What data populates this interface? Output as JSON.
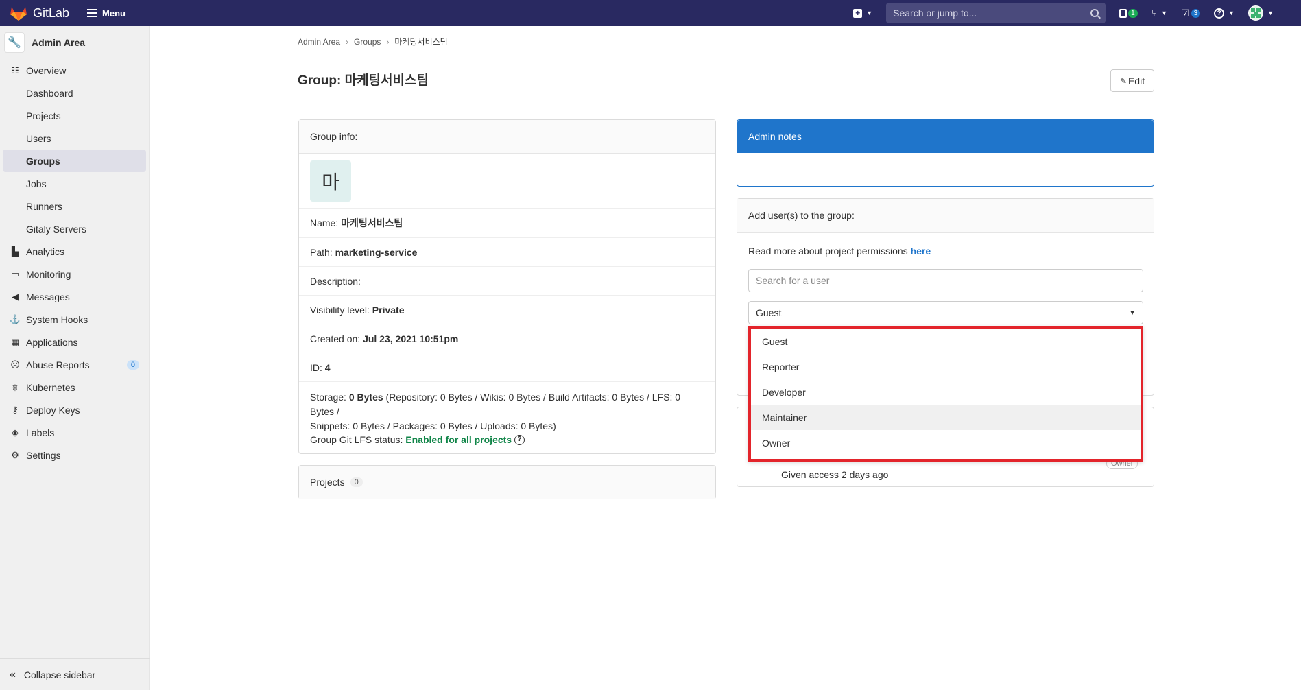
{
  "topnav": {
    "brand": "GitLab",
    "menu_label": "Menu",
    "search_placeholder": "Search or jump to...",
    "issues_count": "1",
    "todos_count": "3",
    "icons": [
      "gitlab-logo",
      "hamburger-icon",
      "plus-square-icon",
      "search-icon",
      "issues-icon",
      "merge-request-icon",
      "todo-icon",
      "help-icon",
      "user-avatar"
    ]
  },
  "sidebar": {
    "header": "Admin Area",
    "overview": "Overview",
    "overview_items": [
      "Dashboard",
      "Projects",
      "Users",
      "Groups",
      "Jobs",
      "Runners",
      "Gitaly Servers"
    ],
    "active": "Groups",
    "items": [
      {
        "label": "Analytics",
        "icon": "chart-icon"
      },
      {
        "label": "Monitoring",
        "icon": "monitor-icon"
      },
      {
        "label": "Messages",
        "icon": "bullhorn-icon"
      },
      {
        "label": "System Hooks",
        "icon": "hook-icon"
      },
      {
        "label": "Applications",
        "icon": "apps-icon"
      },
      {
        "label": "Abuse Reports",
        "icon": "abuse-icon",
        "badge": "0"
      },
      {
        "label": "Kubernetes",
        "icon": "kubernetes-icon"
      },
      {
        "label": "Deploy Keys",
        "icon": "key-icon"
      },
      {
        "label": "Labels",
        "icon": "label-icon"
      },
      {
        "label": "Settings",
        "icon": "settings-icon"
      }
    ],
    "collapse": "Collapse sidebar"
  },
  "breadcrumb": [
    "Admin Area",
    "Groups",
    "마케팅서비스팀"
  ],
  "page_title": "Group: 마케팅서비스팀",
  "edit_label": "Edit",
  "group_info": {
    "header": "Group info:",
    "avatar_letter": "마",
    "name_label": "Name:",
    "name_value": "마케팅서비스팀",
    "path_label": "Path:",
    "path_value": "marketing-service",
    "description_label": "Description:",
    "visibility_label": "Visibility level:",
    "visibility_value": "Private",
    "created_label": "Created on:",
    "created_value": "Jul 23, 2021 10:51pm",
    "id_label": "ID:",
    "id_value": "4",
    "storage_label": "Storage:",
    "storage_value": "0 Bytes",
    "storage_detail_1": "(Repository: 0 Bytes / Wikis: 0 Bytes / Build Artifacts: 0 Bytes / LFS: 0 Bytes /",
    "storage_detail_2": "Snippets: 0 Bytes / Packages: 0 Bytes / Uploads: 0 Bytes)",
    "lfs_label": "Group Git LFS status:",
    "lfs_value": "Enabled for all projects"
  },
  "projects": {
    "label": "Projects",
    "count": "0"
  },
  "admin_notes": {
    "header": "Admin notes"
  },
  "add_users": {
    "header": "Add user(s) to the group:",
    "permissions_text": "Read more about project permissions",
    "permissions_link": "here",
    "search_placeholder": "Search for a user",
    "selected_role": "Guest",
    "role_options": [
      "Guest",
      "Reporter",
      "Developer",
      "Maintainer",
      "Owner"
    ],
    "highlighted_option": "Maintainer"
  },
  "member": {
    "access_text": "Given access 2 days ago",
    "role_badge": "Owner"
  },
  "colors": {
    "topnav": "#292961",
    "accent": "#1f75cb",
    "highlight_box": "#e3242b",
    "success": "#108548"
  }
}
